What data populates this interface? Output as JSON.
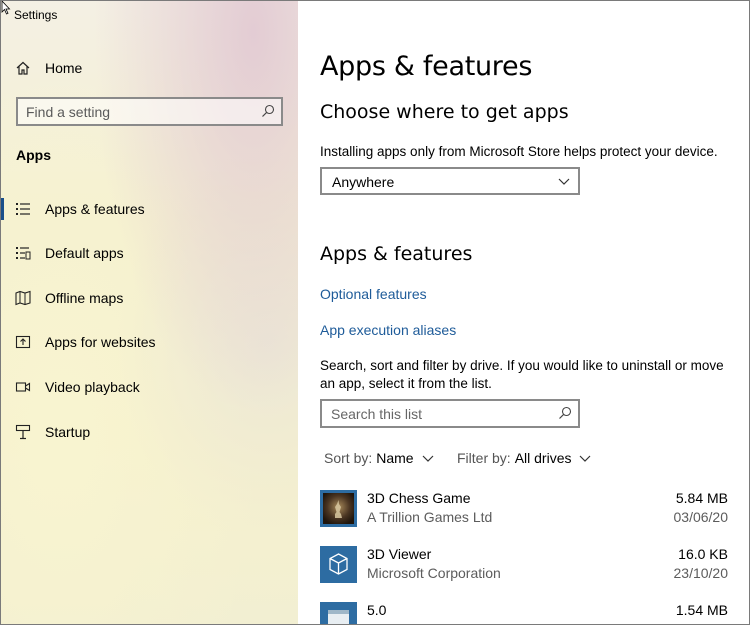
{
  "window": {
    "title": "Settings"
  },
  "sidebar": {
    "home_label": "Home",
    "search_placeholder": "Find a setting",
    "section_label": "Apps",
    "items": [
      {
        "label": "Apps & features",
        "icon": "apps-features-icon",
        "selected": true
      },
      {
        "label": "Default apps",
        "icon": "default-apps-icon",
        "selected": false
      },
      {
        "label": "Offline maps",
        "icon": "offline-maps-icon",
        "selected": false
      },
      {
        "label": "Apps for websites",
        "icon": "apps-for-websites-icon",
        "selected": false
      },
      {
        "label": "Video playback",
        "icon": "video-playback-icon",
        "selected": false
      },
      {
        "label": "Startup",
        "icon": "startup-icon",
        "selected": false
      }
    ]
  },
  "main": {
    "page_title": "Apps & features",
    "choose_heading": "Choose where to get apps",
    "choose_desc": "Installing apps only from Microsoft Store helps protect your device.",
    "source_dropdown_value": "Anywhere",
    "apps_heading": "Apps & features",
    "links": {
      "optional_features": "Optional features",
      "app_execution_aliases": "App execution aliases"
    },
    "list_desc": "Search, sort and filter by drive. If you would like to uninstall or move an app, select it from the list.",
    "list_search_placeholder": "Search this list",
    "sort": {
      "key": "Sort by:",
      "value": "Name"
    },
    "filter": {
      "key": "Filter by:",
      "value": "All drives"
    },
    "apps": [
      {
        "name": "3D Chess Game",
        "publisher": "A Trillion Games Ltd",
        "size": "5.84 MB",
        "date": "03/06/20"
      },
      {
        "name": "3D Viewer",
        "publisher": "Microsoft Corporation",
        "size": "16.0 KB",
        "date": "23/10/20"
      },
      {
        "name": "5.0",
        "publisher": "",
        "size": "1.54 MB",
        "date": ""
      }
    ]
  },
  "colors": {
    "link": "#1e5b99",
    "selection_bar": "#1a4f8a",
    "tile_blue": "#2d6ca2"
  }
}
